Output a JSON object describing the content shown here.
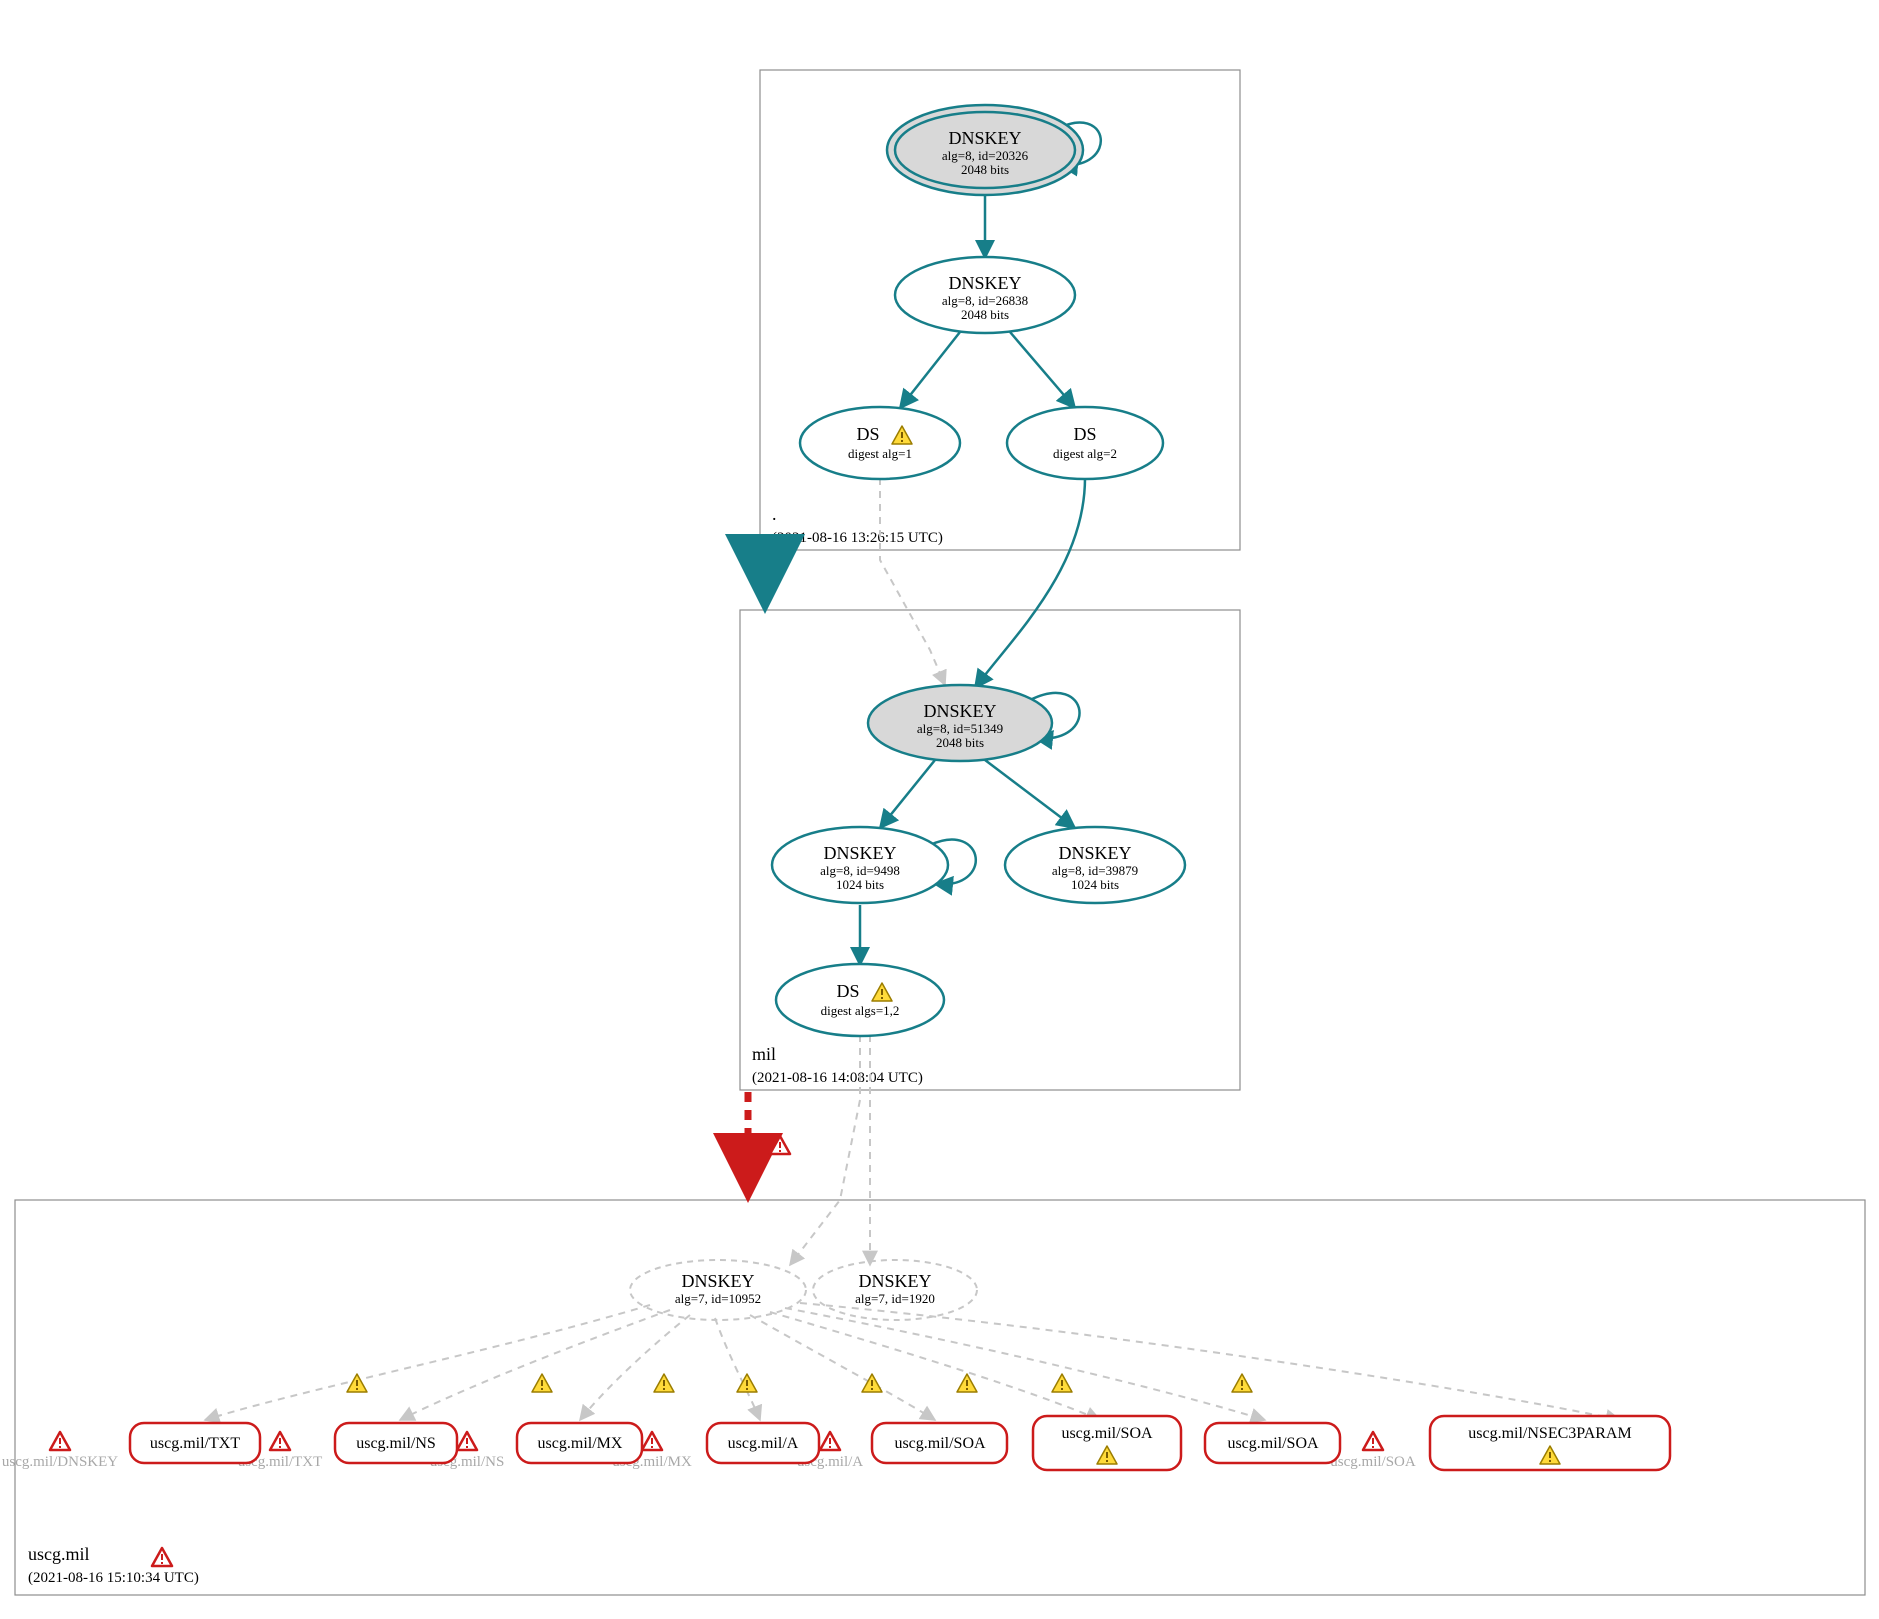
{
  "colors": {
    "teal": "#177e89",
    "red": "#cc1b1b",
    "grey": "#c7c7c7",
    "zone_border": "#8e8e8e"
  },
  "zones": {
    "root": {
      "label": ".",
      "timestamp": "(2021-08-16 13:26:15 UTC)"
    },
    "mil": {
      "label": "mil",
      "timestamp": "(2021-08-16 14:08:04 UTC)"
    },
    "uscg": {
      "label": "uscg.mil",
      "timestamp": "(2021-08-16 15:10:34 UTC)"
    }
  },
  "nodes": {
    "root_ksk": {
      "title": "DNSKEY",
      "line2": "alg=8, id=20326",
      "line3": "2048 bits"
    },
    "root_zsk": {
      "title": "DNSKEY",
      "line2": "alg=8, id=26838",
      "line3": "2048 bits"
    },
    "root_ds1": {
      "title": "DS",
      "line2": "digest alg=1"
    },
    "root_ds2": {
      "title": "DS",
      "line2": "digest alg=2"
    },
    "mil_ksk": {
      "title": "DNSKEY",
      "line2": "alg=8, id=51349",
      "line3": "2048 bits"
    },
    "mil_zsk1": {
      "title": "DNSKEY",
      "line2": "alg=8, id=9498",
      "line3": "1024 bits"
    },
    "mil_zsk2": {
      "title": "DNSKEY",
      "line2": "alg=8, id=39879",
      "line3": "1024 bits"
    },
    "mil_ds": {
      "title": "DS",
      "line2": "digest algs=1,2"
    },
    "uscg_k1": {
      "title": "DNSKEY",
      "line2": "alg=7, id=10952"
    },
    "uscg_k2": {
      "title": "DNSKEY",
      "line2": "alg=7, id=1920"
    }
  },
  "rrlabels": {
    "dnskey": "uscg.mil/DNSKEY",
    "txt": "uscg.mil/TXT",
    "ns": "uscg.mil/NS",
    "mx": "uscg.mil/MX",
    "a": "uscg.mil/A",
    "soa": "uscg.mil/SOA"
  },
  "rrboxes": {
    "txt": "uscg.mil/TXT",
    "ns": "uscg.mil/NS",
    "mx": "uscg.mil/MX",
    "a": "uscg.mil/A",
    "soa1": "uscg.mil/SOA",
    "soa2": "uscg.mil/SOA",
    "soa3": "uscg.mil/SOA",
    "nsec3": "uscg.mil/NSEC3PARAM"
  }
}
